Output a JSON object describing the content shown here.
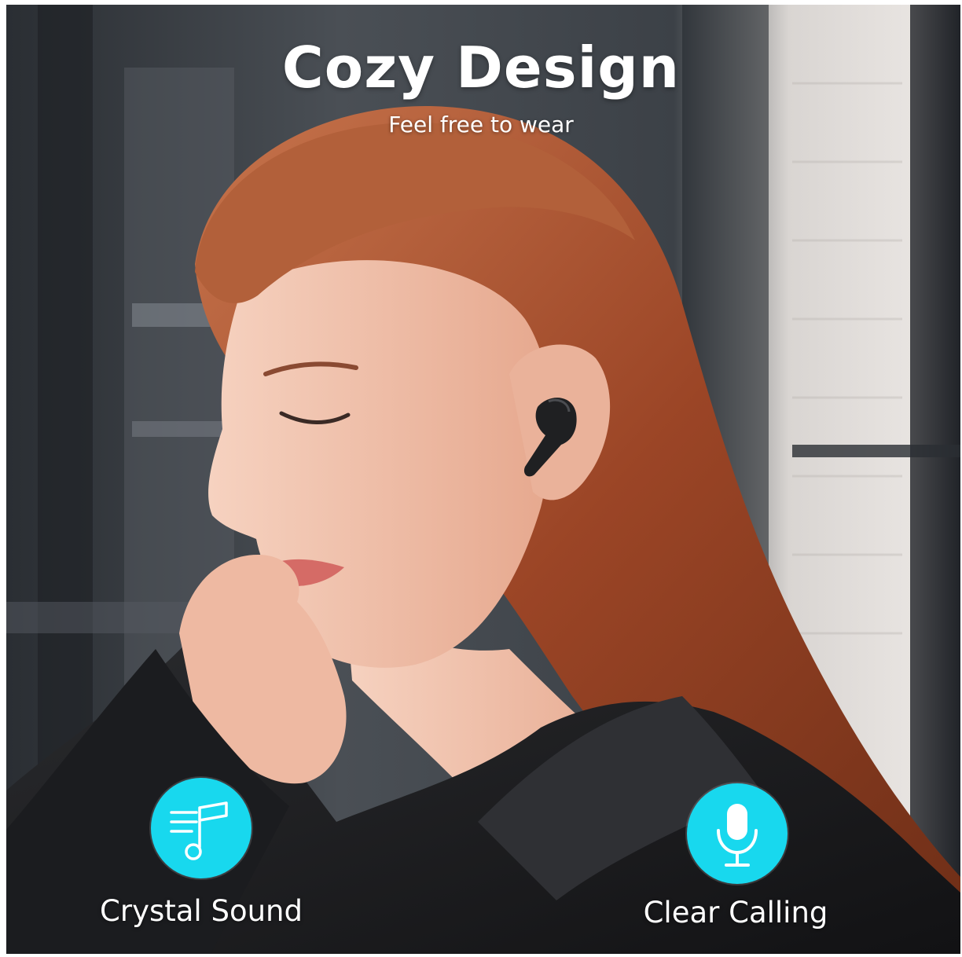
{
  "header": {
    "title": "Cozy Design",
    "subtitle": "Feel free to wear"
  },
  "features": [
    {
      "label": "Crystal Sound",
      "icon": "music-note-icon"
    },
    {
      "label": "Clear Calling",
      "icon": "microphone-icon"
    }
  ],
  "colors": {
    "accent": "#18d8ee",
    "text": "#ffffff",
    "hair": "#a8502e",
    "shirt": "#1c1c1e",
    "skin": "#f1c0a8"
  }
}
